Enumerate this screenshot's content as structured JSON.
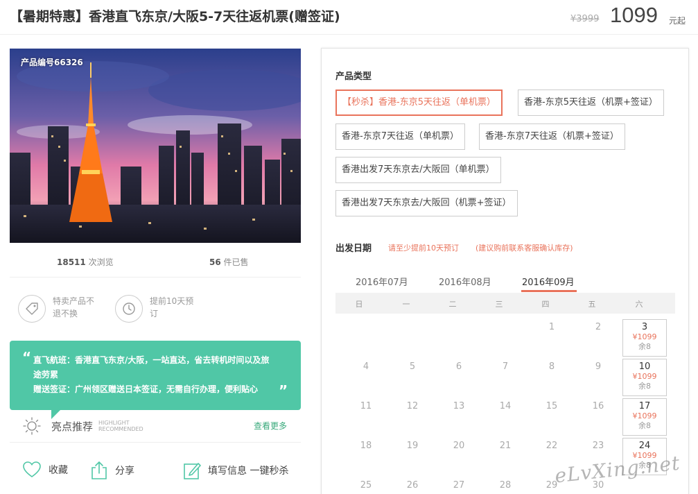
{
  "header": {
    "title": "【暑期特惠】香港直飞东京/大阪5-7天往返机票(赠签证)",
    "original_price": "¥3999",
    "price": "1099",
    "price_unit": "元起"
  },
  "photo": {
    "product_no": "产品编号66326"
  },
  "stats": {
    "views_count": "18511",
    "views_label": "次浏览",
    "sold_count": "56",
    "sold_label": "件已售"
  },
  "features": [
    {
      "icon": "tag-icon",
      "text": "特卖产品不退不换"
    },
    {
      "icon": "clock-icon",
      "text": "提前10天预订"
    }
  ],
  "bubble": {
    "line1": "直飞航班：香港直飞东京/大阪，一站直达，省去转机时间以及旅途劳累",
    "line2": "赠送签证：广州领区赠送日本签证，无需自行办理，便利贴心"
  },
  "highlight": {
    "title": "亮点推荐",
    "en_line1": "HIGHLIGHT",
    "en_line2": "RECOMMENDED",
    "more": "查看更多"
  },
  "actions": {
    "favorite": "收藏",
    "share": "分享",
    "order": "填写信息 一键秒杀"
  },
  "panel": {
    "product_type_title": "产品类型",
    "options": [
      "【秒杀】香港-东京5天往返（单机票）",
      "香港-东京5天往返（机票+签证）",
      "香港-东京7天往返（单机票）",
      "香港-东京7天往返（机票+签证）",
      "香港出发7天东京去/大阪回（单机票）",
      "香港出发7天东京去/大阪回（机票+签证）"
    ],
    "selected_option": 0,
    "date_title": "出发日期",
    "note1": "请至少提前10天预订",
    "note2": "(建议购前联系客服确认库存)",
    "months": [
      "2016年07月",
      "2016年08月",
      "2016年09月"
    ],
    "active_month": 2,
    "weekdays": [
      "日",
      "一",
      "二",
      "三",
      "四",
      "五",
      "六"
    ],
    "available": [
      {
        "day": "3",
        "price": "¥1099",
        "left": "余8"
      },
      {
        "day": "10",
        "price": "¥1099",
        "left": "余8"
      },
      {
        "day": "17",
        "price": "¥1099",
        "left": "余8"
      },
      {
        "day": "24",
        "price": "¥1099",
        "left": "余8"
      }
    ],
    "days": [
      "1",
      "2",
      "4",
      "5",
      "6",
      "7",
      "8",
      "9",
      "11",
      "12",
      "13",
      "14",
      "15",
      "16",
      "18",
      "19",
      "20",
      "21",
      "22",
      "23",
      "25",
      "26",
      "27",
      "28",
      "29",
      "30"
    ]
  },
  "watermark": "eLvXing.net",
  "colors": {
    "accent": "#e9735b",
    "green": "#50c7a6",
    "link_green": "#3aaa7c"
  }
}
